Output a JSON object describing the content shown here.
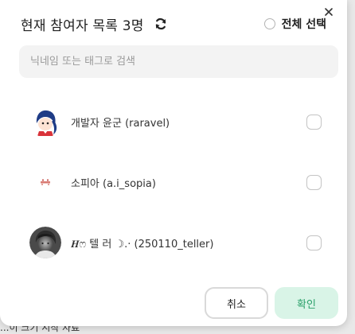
{
  "modal": {
    "title": "현재 참여자 목록 3명",
    "select_all_label": "전체 선택",
    "search_placeholder": "닉네임 또는 태그로 검색",
    "participants": [
      {
        "name": "개발자 윤군 (raravel)",
        "avatar": "anime-character-avatar"
      },
      {
        "name": "소피아 (a.i_sopia)",
        "avatar": "small-icon-avatar"
      },
      {
        "name": "𝑯ෆ 텔 러 ☽.· (250110_teller)",
        "avatar": "photo-avatar"
      }
    ],
    "cancel_label": "취소",
    "confirm_label": "확인"
  },
  "background": {
    "partial_text": "...이 크기 시작 자료"
  },
  "colors": {
    "confirm_bg": "#d9f4e7",
    "confirm_text": "#2aa06a",
    "search_bg": "#f3f3f3"
  },
  "icons": [
    "close-icon",
    "refresh-icon"
  ]
}
